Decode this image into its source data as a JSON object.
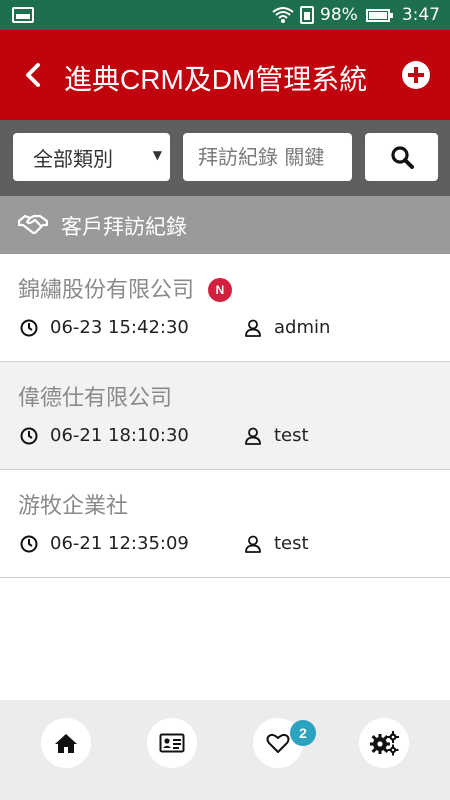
{
  "status_bar": {
    "battery": "98%",
    "time": "3:47"
  },
  "app_bar": {
    "title": "進典CRM及DM管理系統"
  },
  "filter": {
    "category_selected": "全部類別",
    "search_placeholder": "拜訪紀錄 關鍵"
  },
  "section": {
    "title": "客戶拜訪紀錄"
  },
  "records": [
    {
      "company": "錦繡股份有限公司",
      "badge": "N",
      "datetime": "06-23 15:42:30",
      "user": "admin"
    },
    {
      "company": "偉德仕有限公司",
      "badge": "",
      "datetime": "06-21 18:10:30",
      "user": "test"
    },
    {
      "company": "游牧企業社",
      "badge": "",
      "datetime": "06-21 12:35:09",
      "user": "test"
    }
  ],
  "bottom_nav": {
    "favorites_count": "2"
  },
  "colors": {
    "status_bar": "#1e6f4d",
    "app_bar": "#c0030c",
    "filter_bar": "#5f5f5f",
    "section_header": "#9a9a9a",
    "new_badge": "#d3203f",
    "count_badge": "#2aa3c0"
  },
  "icons": {
    "status_left": "image-icon",
    "wifi": "wifi-icon",
    "sim": "sim-icon",
    "battery": "battery-icon",
    "back": "chevron-left-icon",
    "add": "plus-circle-icon",
    "search": "search-icon",
    "section": "handshake-icon",
    "time": "clock-icon",
    "user": "user-icon",
    "nav": [
      "home-icon",
      "contact-card-icon",
      "heart-icon",
      "gears-icon"
    ]
  }
}
